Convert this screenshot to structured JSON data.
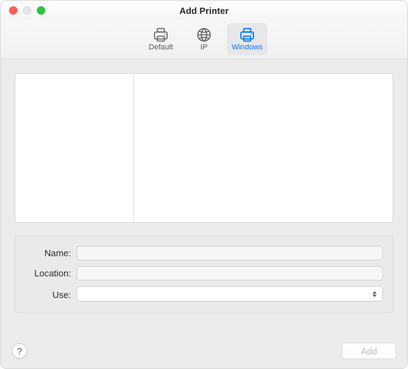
{
  "window": {
    "title": "Add Printer"
  },
  "tabs": {
    "default_label": "Default",
    "ip_label": "IP",
    "windows_label": "Windows",
    "selected": "windows"
  },
  "form": {
    "name_label": "Name:",
    "name_value": "",
    "location_label": "Location:",
    "location_value": "",
    "use_label": "Use:",
    "use_value": ""
  },
  "footer": {
    "help_symbol": "?",
    "add_label": "Add",
    "add_enabled": false
  }
}
